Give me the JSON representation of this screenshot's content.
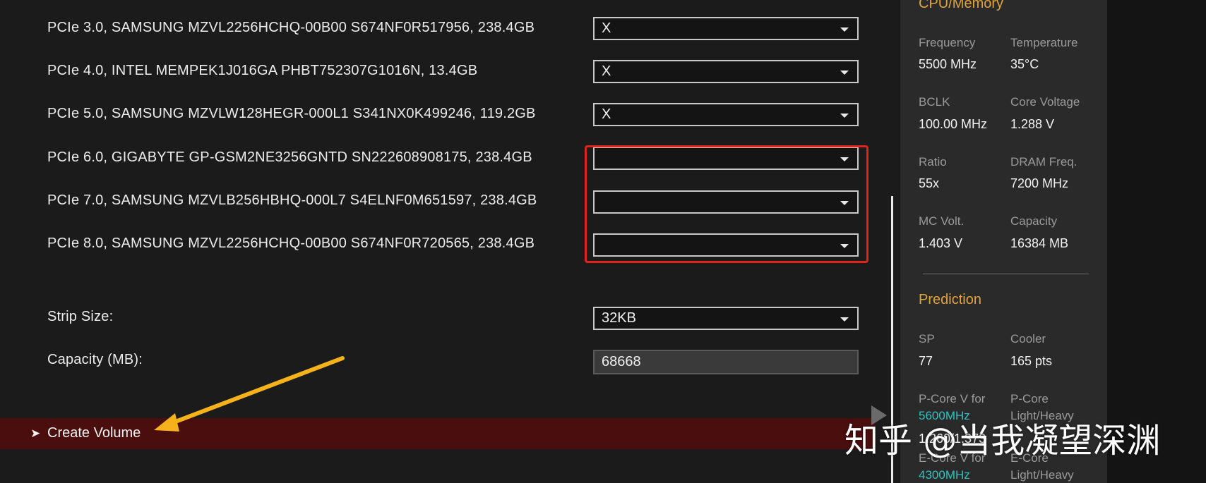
{
  "raid": {
    "drives": [
      {
        "label": "PCIe 3.0, SAMSUNG MZVL2256HCHQ-00B00 S674NF0R517956, 238.4GB",
        "value": "X"
      },
      {
        "label": "PCIe 4.0, INTEL MEMPEK1J016GA PHBT752307G1016N, 13.4GB",
        "value": "X"
      },
      {
        "label": "PCIe 5.0, SAMSUNG MZVLW128HEGR-000L1 S341NX0K499246, 119.2GB",
        "value": "X"
      },
      {
        "label": "PCIe 6.0, GIGABYTE GP-GSM2NE3256GNTD SN222608908175, 238.4GB",
        "value": ""
      },
      {
        "label": "PCIe 7.0, SAMSUNG MZVLB256HBHQ-000L7 S4ELNF0M651597, 238.4GB",
        "value": ""
      },
      {
        "label": "PCIe 8.0, SAMSUNG MZVL2256HCHQ-00B00 S674NF0R720565, 238.4GB",
        "value": ""
      }
    ],
    "strip_size": {
      "label": "Strip Size:",
      "value": "32KB"
    },
    "capacity": {
      "label": "Capacity (MB):",
      "value": "68668"
    },
    "create_volume": {
      "label": "Create Volume"
    }
  },
  "sidebar": {
    "cpu_memory": {
      "title": "CPU/Memory",
      "items": [
        {
          "label": "Frequency",
          "value": "5500 MHz"
        },
        {
          "label": "Temperature",
          "value": "35°C"
        },
        {
          "label": "BCLK",
          "value": "100.00 MHz"
        },
        {
          "label": "Core Voltage",
          "value": "1.288 V"
        },
        {
          "label": "Ratio",
          "value": "55x"
        },
        {
          "label": "DRAM Freq.",
          "value": "7200 MHz"
        },
        {
          "label": "MC Volt.",
          "value": "1.403 V"
        },
        {
          "label": "Capacity",
          "value": "16384 MB"
        }
      ]
    },
    "prediction": {
      "title": "Prediction",
      "items": [
        {
          "label": "SP",
          "value": "77"
        },
        {
          "label": "Cooler",
          "value": "165 pts"
        }
      ],
      "pcore_v_label": "P-Core V for",
      "pcore_v_freq": "5600MHz",
      "pcore_v_value": "1.260/1.373",
      "pcore_lh_label": "P-Core",
      "pcore_lh_sub": "Light/Heavy",
      "ecore_v_label": "E-Core V for",
      "ecore_v_freq": "4300MHz",
      "ecore_lh_label": "E-Core",
      "ecore_lh_sub": "Light/Heavy"
    }
  },
  "watermark": "知乎 @当我凝望深渊",
  "colors": {
    "accent_orange": "#e2a33a",
    "highlight_red": "#e0241b",
    "annotation_arrow": "#f5b21b",
    "cyan": "#2ec4c0",
    "create_bar": "#4a0e0e"
  }
}
